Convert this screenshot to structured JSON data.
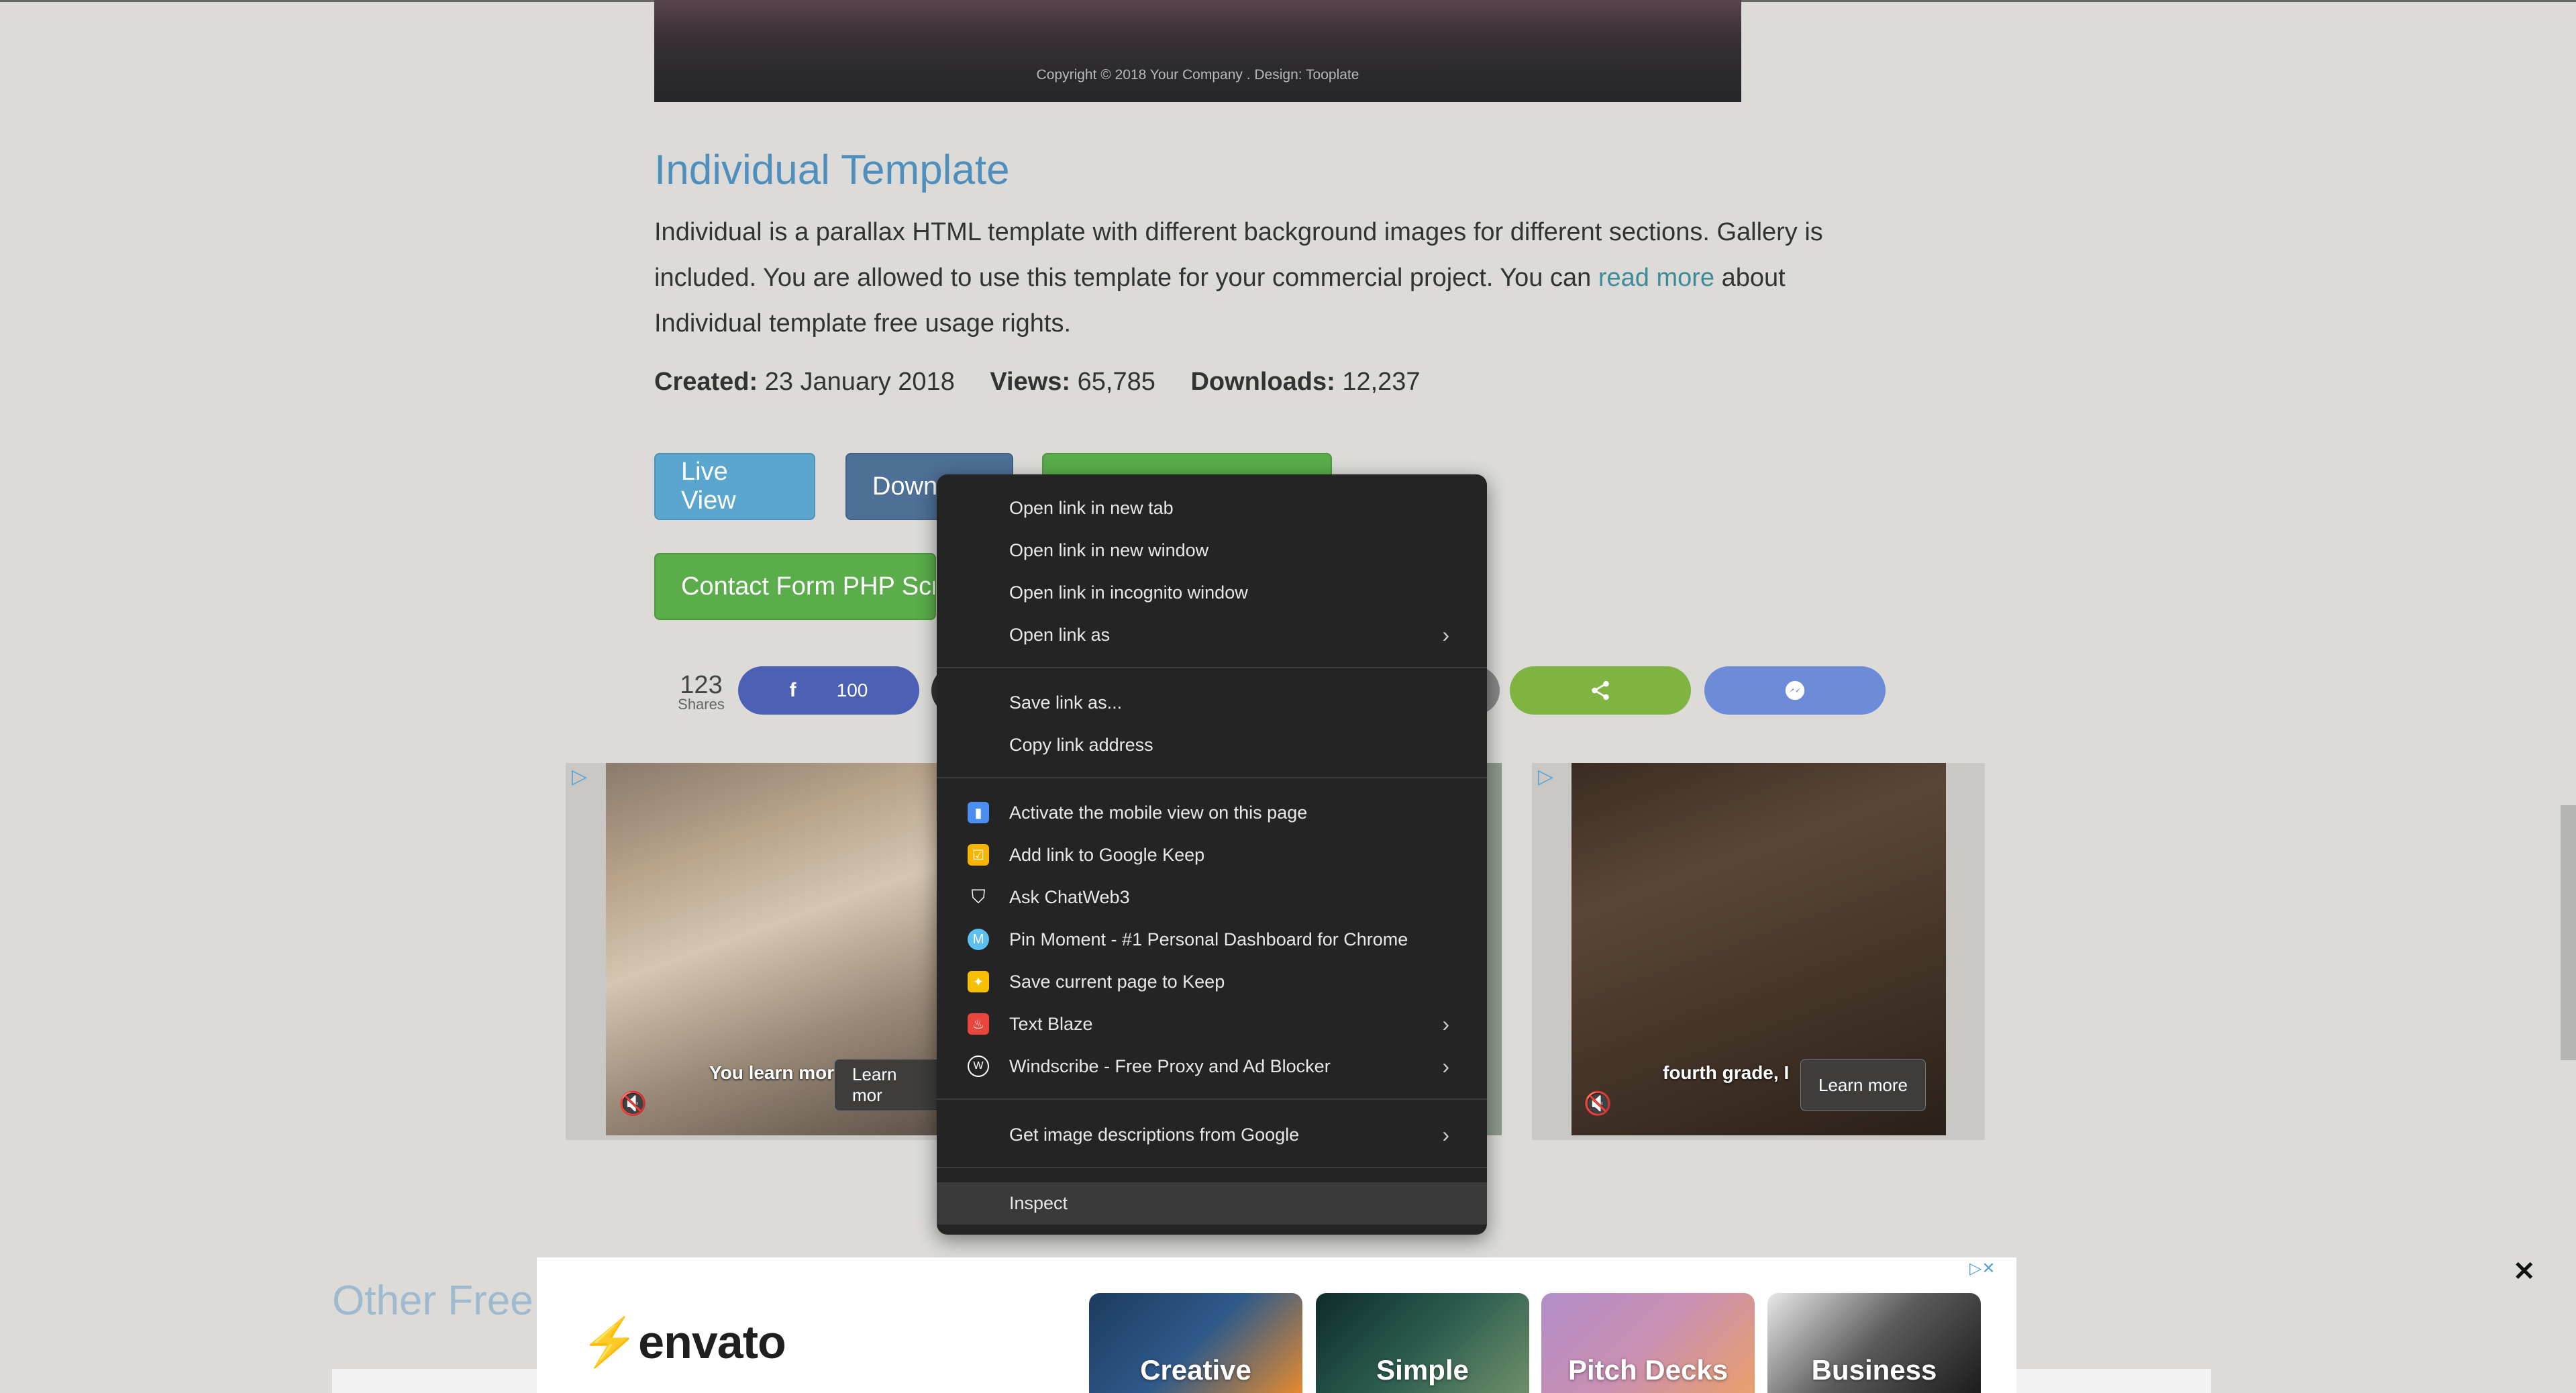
{
  "preview": {
    "copyright": "Copyright © 2018 Your Company . Design: Tooplate"
  },
  "template": {
    "title": "Individual Template",
    "desc_before": "Individual is a parallax HTML template with different background images for different sections. Gallery is included. You are allowed to use this template for your commercial project. You can ",
    "desc_link": "read more",
    "desc_after": " about Individual template free usage rights.",
    "created_label": "Created:",
    "created_value": "23 January 2018",
    "views_label": "Views:",
    "views_value": "65,785",
    "downloads_label": "Downloads:",
    "downloads_value": "12,237"
  },
  "buttons": {
    "live_view": "Live View",
    "download": "Down",
    "contact": "Contact Form PHP Scr"
  },
  "share": {
    "count": "123",
    "label": "Shares",
    "facebook_count": "100"
  },
  "ads": {
    "left_caption": "You learn mor",
    "right_caption": "fourth grade, I",
    "learn_more_left": "Learn mor",
    "learn_more_right": "Learn more"
  },
  "context_menu": {
    "items": [
      {
        "label": "Open link in new tab"
      },
      {
        "label": "Open link in new window"
      },
      {
        "label": "Open link in incognito window"
      },
      {
        "label": "Open link as",
        "submenu": true
      },
      {
        "label": "Save link as..."
      },
      {
        "label": "Copy link address"
      },
      {
        "label": "Activate the mobile view on this page",
        "icon": "mobile-view-icon"
      },
      {
        "label": "Add link to Google Keep",
        "icon": "google-keep-icon"
      },
      {
        "label": "Ask ChatWeb3",
        "icon": "shield-check-icon"
      },
      {
        "label": "Pin Moment - #1 Personal Dashboard for Chrome",
        "icon": "pin-moment-icon"
      },
      {
        "label": "Save current page to Keep",
        "icon": "keep-bulb-icon"
      },
      {
        "label": "Text Blaze",
        "icon": "text-blaze-icon",
        "submenu": true
      },
      {
        "label": "Windscribe - Free Proxy and Ad Blocker",
        "icon": "windscribe-icon",
        "submenu": true
      },
      {
        "label": "Get image descriptions from Google",
        "submenu": true
      },
      {
        "label": "Inspect"
      }
    ]
  },
  "bottom": {
    "other_heading": "Other Free",
    "envato_logo": "envato",
    "tiles": [
      "Creative",
      "Simple",
      "Pitch Decks",
      "Business"
    ]
  },
  "colors": {
    "menu_bg": "#242424",
    "title": "#4f8fbd",
    "green": "#5aad4a",
    "facebook": "#4c61b3"
  }
}
